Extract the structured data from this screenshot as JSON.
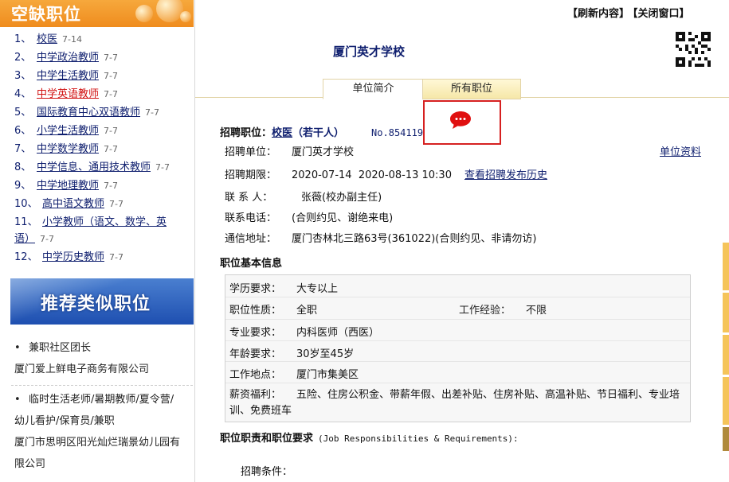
{
  "sidebar": {
    "vacancies_title": "空缺职位",
    "vacancies": [
      {
        "num": "1、",
        "label": "校医",
        "date": "7-14"
      },
      {
        "num": "2、",
        "label": "中学政治教师",
        "date": "7-7"
      },
      {
        "num": "3、",
        "label": "中学生活教师",
        "date": "7-7"
      },
      {
        "num": "4、",
        "label": "中学英语教师",
        "date": "7-7"
      },
      {
        "num": "5、",
        "label": "国际教育中心双语教师",
        "date": "7-7"
      },
      {
        "num": "6、",
        "label": "小学生活教师",
        "date": "7-7"
      },
      {
        "num": "7、",
        "label": "中学数学教师",
        "date": "7-7"
      },
      {
        "num": "8、",
        "label": "中学信息、通用技术教师",
        "date": "7-7"
      },
      {
        "num": "9、",
        "label": "中学地理教师",
        "date": "7-7"
      },
      {
        "num": "10、",
        "label": "高中语文教师",
        "date": "7-7"
      },
      {
        "num": "11、",
        "label": "小学教师（语文、数学、英",
        "label2": "语）",
        "date": "7-7"
      },
      {
        "num": "12、",
        "label": "中学历史教师",
        "date": "7-7"
      }
    ],
    "recommend_title": "推荐类似职位",
    "recommend": [
      {
        "title": "兼职社区团长",
        "company": "厦门爱上鲜电子商务有限公司"
      },
      {
        "title": "临时生活老师/暑期教师/夏令营/",
        "title2": "幼儿看护/保育员/兼职",
        "company": "厦门市思明区阳光灿烂瑞景幼儿园有",
        "company2": "限公司"
      }
    ]
  },
  "topbar": {
    "refresh": "【刷新内容】",
    "close": "【关闭窗口】"
  },
  "school_name": "厦门英才学校",
  "tabs": {
    "intro": "单位简介",
    "all": "所有职位"
  },
  "post": {
    "label": "招聘职位：",
    "position": "校医",
    "count": "（若干人）",
    "number": "No.854119",
    "unit_label": "招聘单位：",
    "unit": "厦门英才学校",
    "unit_info": "单位资料",
    "period_label": "招聘期限：",
    "period": "2020-07-14  2020-08-13 10:30",
    "history": "查看招聘发布历史",
    "contact_label": "联 系 人：",
    "contact": "张薇(校办副主任)",
    "phone_label": "联系电话：",
    "phone": "(合则约见、谢绝来电)",
    "address_label": "通信地址：",
    "address": "厦门杏林北三路63号(361022)(合则约见、非请勿访)"
  },
  "basic_info": {
    "title": "职位基本信息",
    "edu_label": "学历要求：",
    "edu": "大专以上",
    "nature_label": "职位性质：",
    "nature": "全职",
    "exp_label": "工作经验：",
    "exp": "不限",
    "major_label": "专业要求：",
    "major": "内科医师（西医）",
    "age_label": "年龄要求：",
    "age": "30岁至45岁",
    "place_label": "工作地点：",
    "place": "厦门市集美区",
    "salary_label": "薪资福利：",
    "salary": "五险、住房公积金、带薪年假、出差补贴、住房补贴、高温补贴、节日福利、专业培训、免费班车"
  },
  "duties": {
    "title": "职位职责和职位要求",
    "title_en": "(Job Responsibilities & Requirements):",
    "conditions": "招聘条件："
  },
  "colors": {
    "accent_orange": "#ef8c1e",
    "link_blue": "#0e1e6e",
    "highlight_red": "#d62020"
  }
}
